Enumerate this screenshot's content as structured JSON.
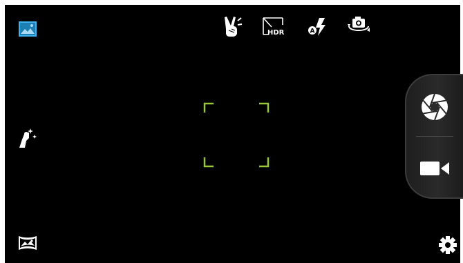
{
  "screen": {
    "name": "camera-viewfinder",
    "background": "#000000",
    "accent": "#29a3e1",
    "focus_color": "#9ac43a"
  },
  "top_bar": {
    "items": [
      {
        "icon": "gallery-icon",
        "active": true
      },
      {
        "icon": "gesture-shot-icon"
      },
      {
        "icon": "hdr-off-icon",
        "label": "HDR"
      },
      {
        "icon": "flash-auto-icon",
        "badge": "A"
      },
      {
        "icon": "switch-camera-icon"
      }
    ]
  },
  "left_bar": {
    "items": [
      {
        "icon": "beauty-mode-icon"
      },
      {
        "icon": "panorama-icon"
      }
    ]
  },
  "capture_panel": {
    "photo_shutter": "shutter-icon",
    "video_record": "video-camera-icon"
  },
  "settings": {
    "icon": "gear-icon"
  }
}
